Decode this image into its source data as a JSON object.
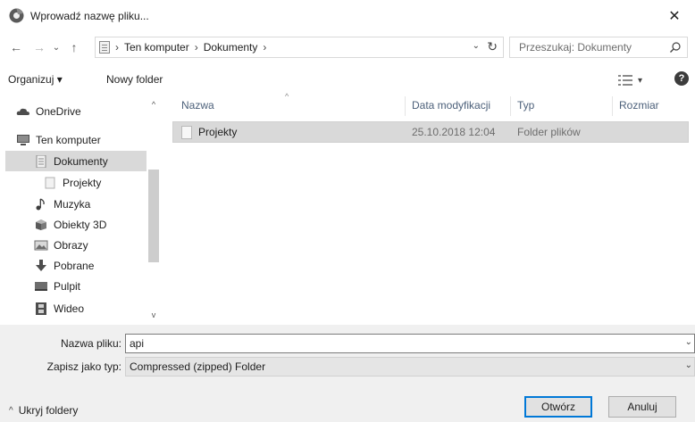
{
  "window": {
    "title": "Wprowadź nazwę pliku...",
    "close_glyph": "✕"
  },
  "navigation": {
    "back_glyph": "←",
    "forward_glyph": "→",
    "recent_glyph": "⌄",
    "up_glyph": "↑",
    "breadcrumb": [
      "Ten komputer",
      "Dokumenty"
    ],
    "separator": "›",
    "dropdown_glyph": "⌄",
    "refresh_glyph": "↻"
  },
  "search": {
    "placeholder": "Przeszukaj: Dokumenty"
  },
  "toolbar": {
    "organize_label": "Organizuj ▾",
    "new_folder_label": "Nowy folder",
    "view_dropdown_glyph": "▾",
    "help_glyph": "?"
  },
  "sidebar": {
    "items": [
      {
        "label": "OneDrive",
        "icon": "cloud-icon"
      },
      {
        "label": "Ten komputer",
        "icon": "computer-icon"
      },
      {
        "label": "Dokumenty",
        "icon": "documents-icon",
        "selected": true
      },
      {
        "label": "Projekty",
        "icon": "folder-icon"
      },
      {
        "label": "Muzyka",
        "icon": "music-icon"
      },
      {
        "label": "Obiekty 3D",
        "icon": "3d-objects-icon"
      },
      {
        "label": "Obrazy",
        "icon": "pictures-icon"
      },
      {
        "label": "Pobrane",
        "icon": "downloads-icon"
      },
      {
        "label": "Pulpit",
        "icon": "desktop-icon"
      },
      {
        "label": "Wideo",
        "icon": "video-icon"
      }
    ],
    "scroll_up_glyph": "^",
    "scroll_down_glyph": "v"
  },
  "file_list": {
    "columns": [
      "Nazwa",
      "Data modyfikacji",
      "Typ",
      "Rozmiar"
    ],
    "sort_glyph": "^",
    "rows": [
      {
        "name": "Projekty",
        "modified": "25.10.2018 12:04",
        "type": "Folder plików",
        "size": ""
      }
    ]
  },
  "form": {
    "filename_label": "Nazwa pliku:",
    "filename_value": "api",
    "filetype_label": "Zapisz jako typ:",
    "filetype_value": "Compressed (zipped) Folder",
    "dropdown_glyph": "⌄"
  },
  "footer": {
    "hide_folders_label": "Ukryj foldery",
    "hide_folders_glyph": "^",
    "open_label": "Otwórz",
    "cancel_label": "Anuluj"
  },
  "colors": {
    "accent": "#0078d7",
    "selection": "#d9d9d9",
    "bottom_panel": "#f0f0f0",
    "column_header_text": "#4c607a"
  }
}
